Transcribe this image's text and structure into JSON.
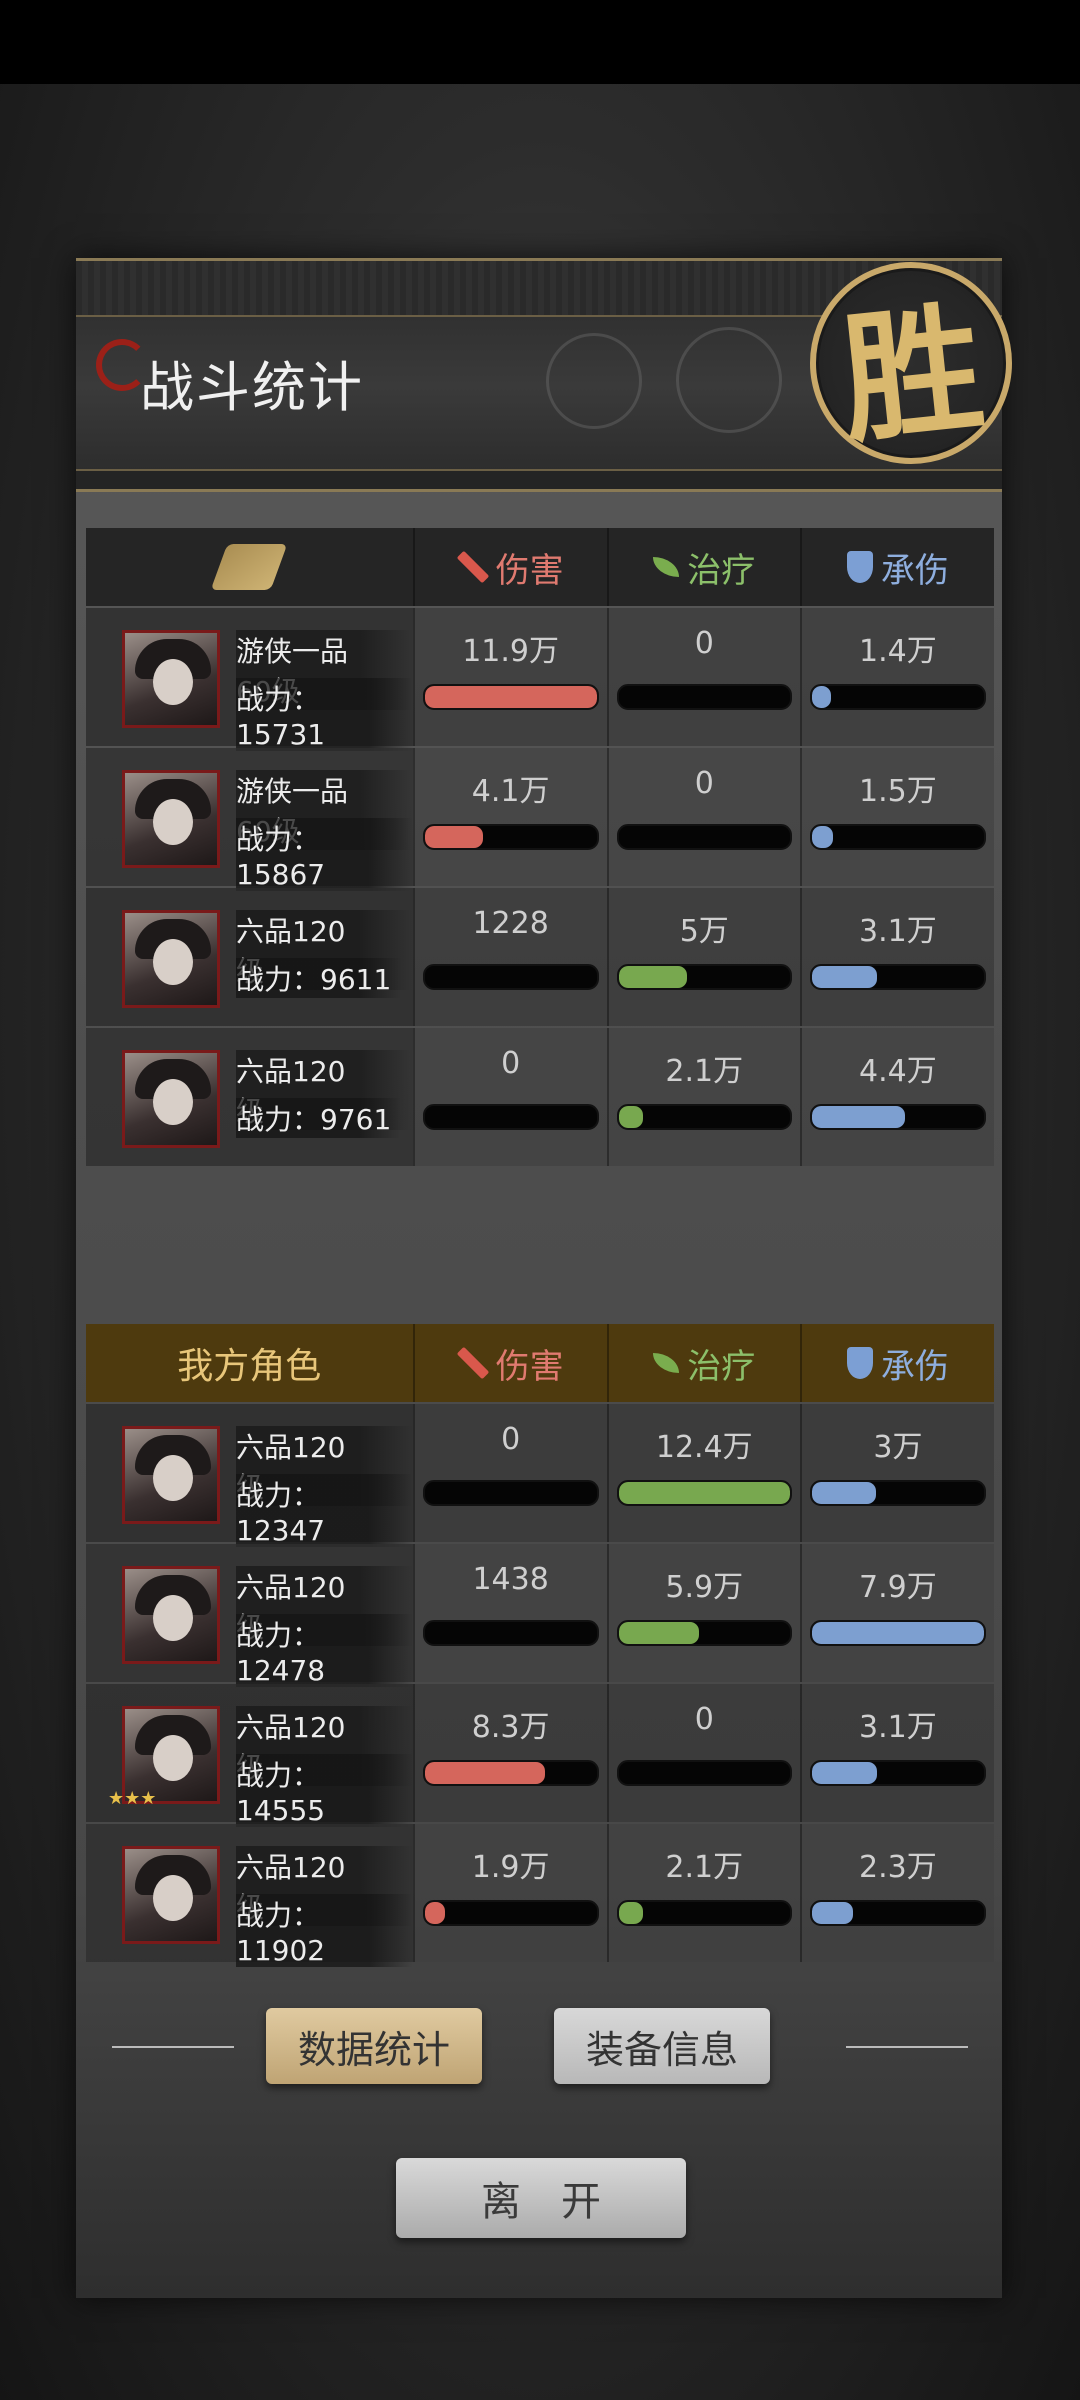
{
  "title": "战斗统计",
  "result_badge": "胜",
  "columns": {
    "damage": "伤害",
    "heal": "治疗",
    "tank": "承伤"
  },
  "enemy_rows": [
    {
      "name": "游侠一品60级",
      "power": "战力：15731",
      "damage": "11.9万",
      "heal": "0",
      "tank": "1.4万",
      "damage_pct": 100,
      "heal_pct": 0,
      "tank_pct": 11
    },
    {
      "name": "游侠一品60级",
      "power": "战力：15867",
      "damage": "4.1万",
      "heal": "0",
      "tank": "1.5万",
      "damage_pct": 34,
      "heal_pct": 0,
      "tank_pct": 12
    },
    {
      "name": "六品120级",
      "power": "战力：9611",
      "damage": "1228",
      "heal": "5万",
      "tank": "3.1万",
      "damage_pct": 0,
      "heal_pct": 40,
      "tank_pct": 38
    },
    {
      "name": "六品120级",
      "power": "战力：9761",
      "damage": "0",
      "heal": "2.1万",
      "tank": "4.4万",
      "damage_pct": 0,
      "heal_pct": 14,
      "tank_pct": 54
    }
  ],
  "ally_header": "我方角色",
  "ally_rows": [
    {
      "name": "六品120级",
      "power": "战力：12347",
      "damage": "0",
      "heal": "12.4万",
      "tank": "3万",
      "damage_pct": 0,
      "heal_pct": 100,
      "tank_pct": 37
    },
    {
      "name": "六品120级",
      "power": "战力：12478",
      "damage": "1438",
      "heal": "5.9万",
      "tank": "7.9万",
      "damage_pct": 0,
      "heal_pct": 47,
      "tank_pct": 100
    },
    {
      "name": "六品120级",
      "power": "战力：14555",
      "damage": "8.3万",
      "heal": "0",
      "tank": "3.1万",
      "damage_pct": 70,
      "heal_pct": 0,
      "tank_pct": 38,
      "stars": 3
    },
    {
      "name": "六品120级",
      "power": "战力：11902",
      "damage": "1.9万",
      "heal": "2.1万",
      "tank": "2.3万",
      "damage_pct": 12,
      "heal_pct": 14,
      "tank_pct": 24
    }
  ],
  "tabs": {
    "stats": "数据统计",
    "equipment": "装备信息"
  },
  "leave_button": "离开",
  "colors": {
    "damage": "#d5665c",
    "heal": "#78a84f",
    "tank": "#7d9fd0",
    "gold": "#d9b86e",
    "ally_header_bg": "#4e3a0e"
  },
  "icons": {
    "damage": "sword-icon",
    "heal": "leaf-icon",
    "tank": "shield-icon",
    "enemy": "enemy-crest-icon"
  }
}
